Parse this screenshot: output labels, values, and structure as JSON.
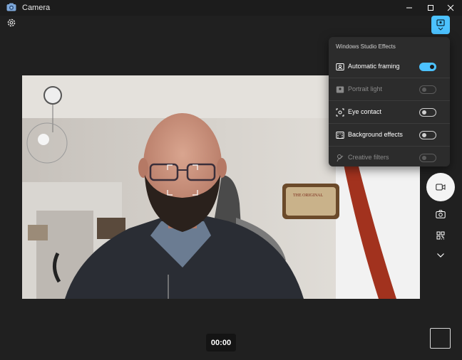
{
  "window": {
    "title": "Camera"
  },
  "effects_panel": {
    "title": "Windows Studio Effects",
    "items": [
      {
        "label": "Automatic framing",
        "state": "on",
        "icon": "framing-icon"
      },
      {
        "label": "Portrait light",
        "state": "disabled",
        "icon": "portrait-light-icon"
      },
      {
        "label": "Eye contact",
        "state": "off",
        "icon": "eye-contact-icon"
      },
      {
        "label": "Background effects",
        "state": "off",
        "icon": "background-effects-icon"
      },
      {
        "label": "Creative filters",
        "state": "disabled",
        "icon": "creative-filters-icon"
      }
    ]
  },
  "recording": {
    "timer": "00:00"
  },
  "colors": {
    "accent": "#4cc2ff",
    "background": "#202020",
    "panel": "#2c2c2c"
  }
}
